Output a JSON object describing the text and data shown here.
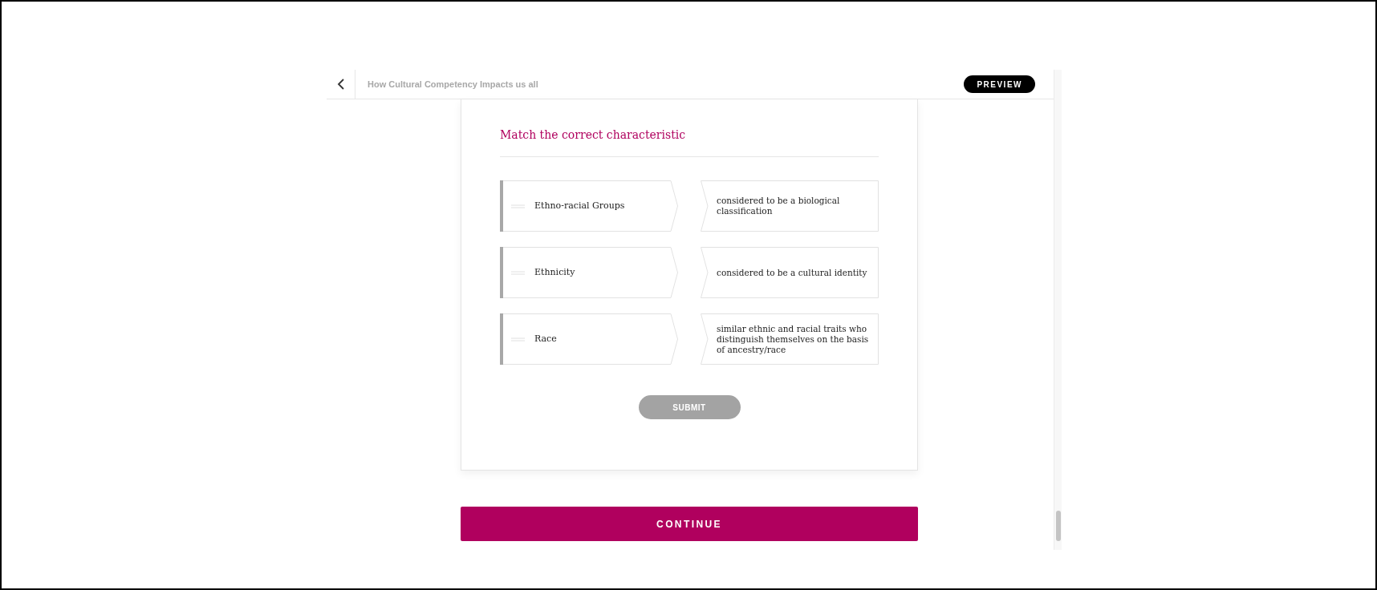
{
  "header": {
    "title": "How Cultural Competency Impacts us all",
    "badge": "PREVIEW"
  },
  "question": {
    "title": "Match the correct characteristic",
    "pairs": [
      {
        "prompt": "Ethno-racial Groups",
        "answer": "considered to be a biological classification"
      },
      {
        "prompt": "Ethnicity",
        "answer": "considered to be a cultural identity"
      },
      {
        "prompt": "Race",
        "answer": "similar ethnic and racial traits who distinguish themselves on the basis of ancestry/race"
      }
    ],
    "submit": {
      "label": "SUBMIT",
      "disabled": true
    }
  },
  "continue_button": "CONTINUE"
}
